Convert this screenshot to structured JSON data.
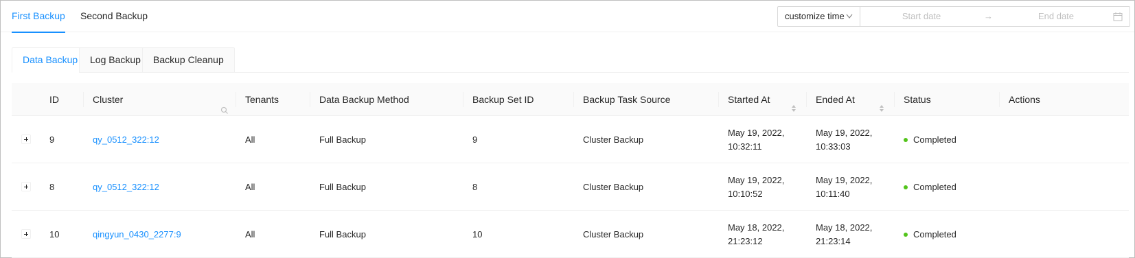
{
  "top_tabs": [
    {
      "label": "First Backup",
      "active": true
    },
    {
      "label": "Second Backup",
      "active": false
    }
  ],
  "date_range": {
    "mode": "customize time",
    "start_placeholder": "Start date",
    "end_placeholder": "End date",
    "separator": "→"
  },
  "sub_tabs": [
    {
      "label": "Data Backup",
      "active": true
    },
    {
      "label": "Log Backup",
      "active": false
    },
    {
      "label": "Backup Cleanup",
      "active": false
    }
  ],
  "table": {
    "columns": {
      "id": "ID",
      "cluster": "Cluster",
      "tenants": "Tenants",
      "method": "Data Backup Method",
      "set_id": "Backup Set ID",
      "source": "Backup Task Source",
      "started": "Started At",
      "ended": "Ended At",
      "status": "Status",
      "actions": "Actions"
    },
    "rows": [
      {
        "id": "9",
        "cluster": "qy_0512_322:12",
        "tenants": "All",
        "method": "Full Backup",
        "set_id": "9",
        "source": "Cluster Backup",
        "started_date": "May 19, 2022,",
        "started_time": "10:32:11",
        "ended_date": "May 19, 2022,",
        "ended_time": "10:33:03",
        "status": "Completed"
      },
      {
        "id": "8",
        "cluster": "qy_0512_322:12",
        "tenants": "All",
        "method": "Full Backup",
        "set_id": "8",
        "source": "Cluster Backup",
        "started_date": "May 19, 2022,",
        "started_time": "10:10:52",
        "ended_date": "May 19, 2022,",
        "ended_time": "10:11:40",
        "status": "Completed"
      },
      {
        "id": "10",
        "cluster": "qingyun_0430_2277:9",
        "tenants": "All",
        "method": "Full Backup",
        "set_id": "10",
        "source": "Cluster Backup",
        "started_date": "May 18, 2022,",
        "started_time": "21:23:12",
        "ended_date": "May 18, 2022,",
        "ended_time": "21:23:14",
        "status": "Completed"
      }
    ]
  },
  "colors": {
    "accent": "#1890ff",
    "status_completed": "#52c41a"
  }
}
